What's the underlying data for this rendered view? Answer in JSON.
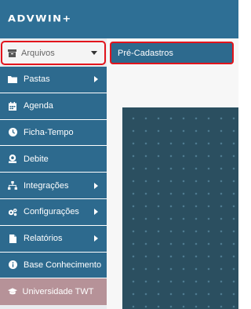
{
  "app": {
    "logo_text": "ADVWIN+"
  },
  "sidebar": {
    "archive": {
      "label": "Arquivos",
      "icon": "archive-icon"
    },
    "items": [
      {
        "label": "Pastas",
        "icon": "folder-icon",
        "has_submenu": true
      },
      {
        "label": "Agenda",
        "icon": "calendar-icon",
        "has_submenu": false
      },
      {
        "label": "Ficha-Tempo",
        "icon": "clock-icon",
        "has_submenu": false
      },
      {
        "label": "Debite",
        "icon": "money-icon",
        "has_submenu": false
      },
      {
        "label": "Integrações",
        "icon": "sitemap-icon",
        "has_submenu": true
      },
      {
        "label": "Configurações",
        "icon": "gears-icon",
        "has_submenu": true
      },
      {
        "label": "Relatórios",
        "icon": "file-icon",
        "has_submenu": true
      },
      {
        "label": "Base Conhecimento",
        "icon": "info-icon",
        "has_submenu": false
      },
      {
        "label": "Universidade TWT",
        "icon": "graduation-cap-icon",
        "has_submenu": false
      }
    ]
  },
  "dropdown": {
    "items": [
      {
        "label": "Pré-Cadastros"
      }
    ]
  },
  "colors": {
    "topbar": "#2e6f95",
    "menu_item": "#2d6a8e",
    "university_item": "#b69298",
    "highlight_border": "#e2141c",
    "content_panel": "#2b4f60"
  }
}
